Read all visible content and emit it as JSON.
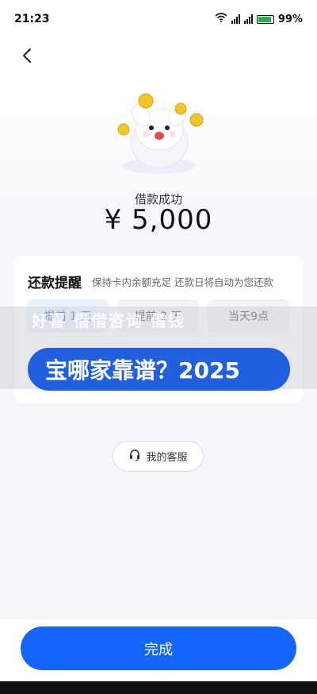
{
  "status_bar": {
    "time": "21:23",
    "battery_percent": "99%",
    "network_label_1": "5G",
    "network_label_2": "5G",
    "battery_level": 0.99
  },
  "result": {
    "success_label": "借款成功",
    "amount": "¥ 5,000"
  },
  "reminder": {
    "title": "还款提醒",
    "description": "保持卡内余额充足 还款日将自动为您还款",
    "options": [
      "提前 1 天",
      "提前 2 天",
      "当天9点"
    ],
    "selected_index": 0
  },
  "overlay": {
    "faded_text": "好喜 借借咨询 借钱",
    "banner_text": "宝哪家靠谱？2025"
  },
  "customer_service": {
    "label": "我的客服"
  },
  "footer": {
    "done_label": "完成"
  },
  "colors": {
    "primary": "#1565ff",
    "banner": "#1f5fe0",
    "selected_bg": "#eaf1ff",
    "coin": "#f2c62b"
  }
}
